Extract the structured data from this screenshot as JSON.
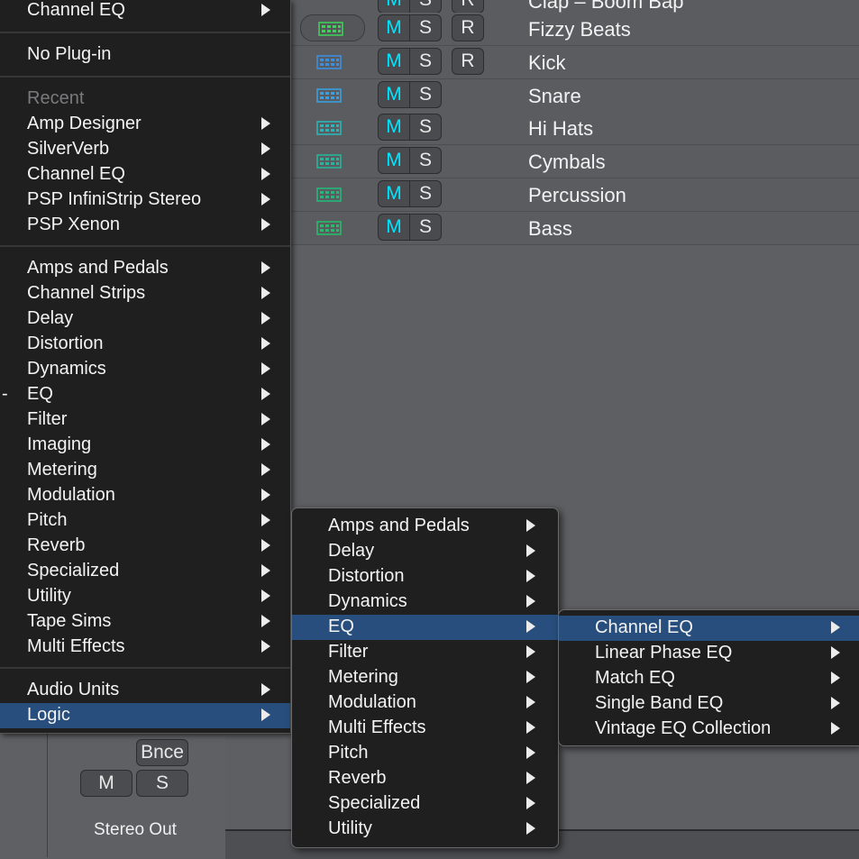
{
  "tracks": [
    {
      "name": "Clap – Boom Bap",
      "mute": "M",
      "solo": "S",
      "record": "R",
      "icon": "green-dot-icon",
      "color": "#19c23b"
    },
    {
      "name": "Fizzy Beats",
      "mute": "M",
      "solo": "S",
      "record": "R",
      "icon": "drum-machine-icon",
      "color": "#3fce5a"
    },
    {
      "name": "Kick",
      "mute": "M",
      "solo": "S",
      "record": "R",
      "icon": "drum-machine-icon",
      "color": "#3b8fe0"
    },
    {
      "name": "Snare",
      "mute": "M",
      "solo": "S",
      "icon": "drum-machine-icon",
      "color": "#3aa0df"
    },
    {
      "name": "Hi Hats",
      "mute": "M",
      "solo": "S",
      "icon": "drum-machine-icon",
      "color": "#2ab5b8"
    },
    {
      "name": "Cymbals",
      "mute": "M",
      "solo": "S",
      "icon": "drum-machine-icon",
      "color": "#25b59a"
    },
    {
      "name": "Percussion",
      "mute": "M",
      "solo": "S",
      "icon": "drum-machine-icon",
      "color": "#22b87c"
    },
    {
      "name": "Bass",
      "mute": "M",
      "solo": "S",
      "icon": "drum-machine-icon",
      "color": "#26bb6a"
    }
  ],
  "mixer": {
    "bounce_label": "Bnce",
    "mute_label": "M",
    "solo_label": "S",
    "channel_name": "Stereo Out"
  },
  "menu_main": {
    "top_item": "Channel EQ",
    "no_plugin": "No Plug-in",
    "recent_header": "Recent",
    "recent_items": [
      "Amp Designer",
      "SilverVerb",
      "Channel EQ",
      "PSP InfiniStrip Stereo",
      "PSP Xenon"
    ],
    "categories": [
      "Amps and Pedals",
      "Channel Strips",
      "Delay",
      "Distortion",
      "Dynamics",
      "EQ",
      "Filter",
      "Imaging",
      "Metering",
      "Modulation",
      "Pitch",
      "Reverb",
      "Specialized",
      "Utility",
      "Tape Sims",
      "Multi Effects"
    ],
    "current_category_marker": "-",
    "audio_units": "Audio Units",
    "logic": "Logic"
  },
  "menu_logic": {
    "items": [
      "Amps and Pedals",
      "Delay",
      "Distortion",
      "Dynamics",
      "EQ",
      "Filter",
      "Metering",
      "Modulation",
      "Multi Effects",
      "Pitch",
      "Reverb",
      "Specialized",
      "Utility"
    ],
    "selected": "EQ"
  },
  "menu_eq": {
    "items": [
      "Channel EQ",
      "Linear Phase EQ",
      "Match EQ",
      "Single Band EQ",
      "Vintage EQ Collection"
    ],
    "selected": "Channel EQ"
  },
  "colors": {
    "menu_bg": "#1f1f20",
    "selection": "#274e7c",
    "mute_cyan": "#00e5ff"
  }
}
